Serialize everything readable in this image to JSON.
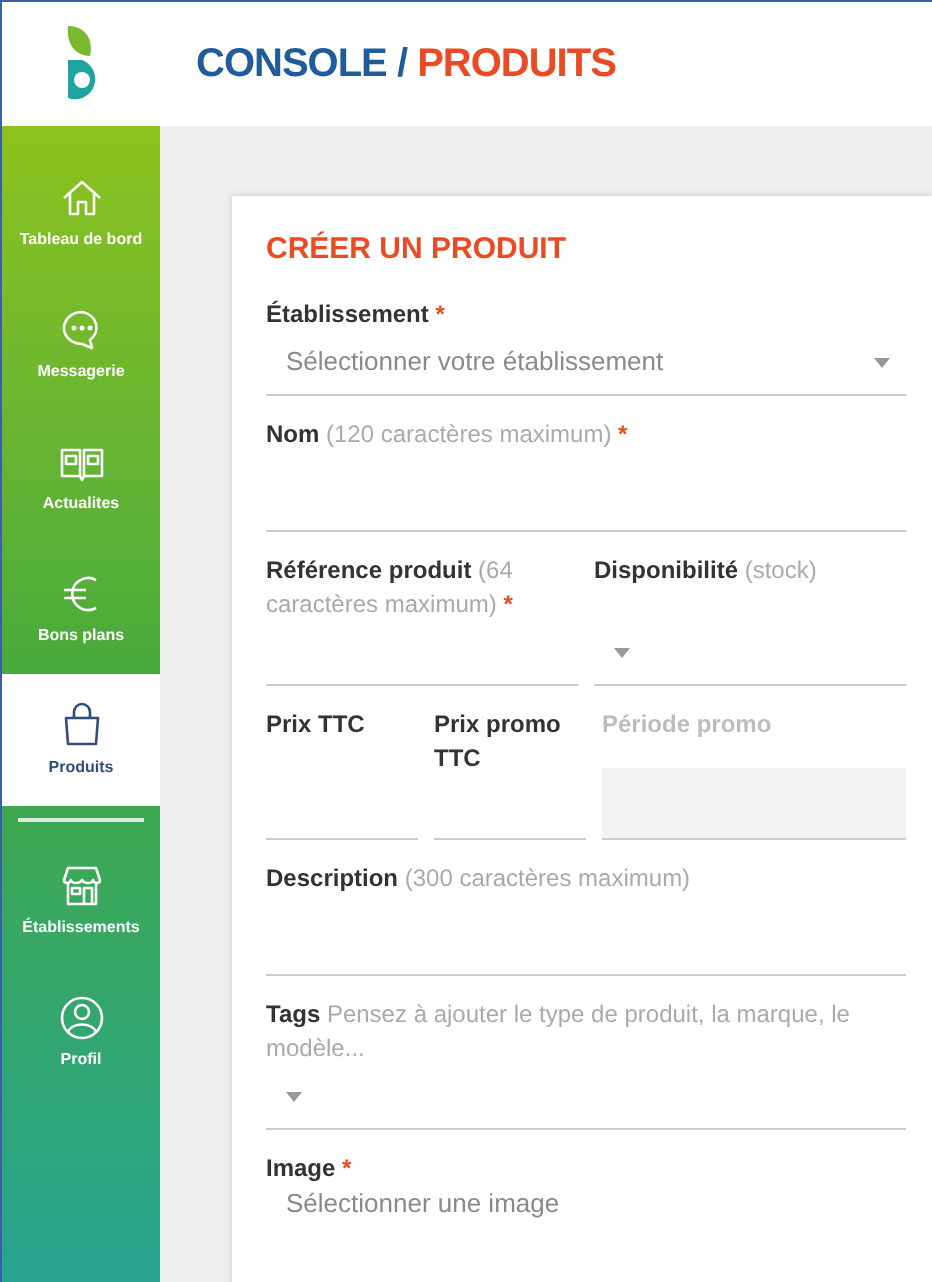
{
  "header": {
    "title": "CONSOLE",
    "separator": " / ",
    "section": "PRODUITS"
  },
  "sidebar": {
    "items": [
      {
        "label": "Tableau de bord",
        "selected": false
      },
      {
        "label": "Messagerie",
        "selected": false
      },
      {
        "label": "Actualites",
        "selected": false
      },
      {
        "label": "Bons plans",
        "selected": false
      },
      {
        "label": "Produits",
        "selected": true
      },
      {
        "label": "Établissements",
        "selected": false
      },
      {
        "label": "Profil",
        "selected": false
      }
    ]
  },
  "form": {
    "title": "CRÉER UN PRODUIT",
    "fields": [
      {
        "label": "Établissement",
        "required_mark": "*",
        "kind": "select",
        "placeholder": "Sélectionner votre établissement"
      },
      {
        "label": "Nom",
        "hint": "(120 caractères maximum)",
        "required_mark": "*",
        "kind": "text"
      },
      {
        "label": "Référence produit",
        "hint": "(64 caractères maximum)",
        "required_mark": "*",
        "kind": "text"
      },
      {
        "label": "Disponibilité",
        "hint": "(stock)",
        "kind": "select"
      },
      {
        "label": "Prix TTC",
        "kind": "text"
      },
      {
        "label": "Prix promo TTC",
        "kind": "text"
      },
      {
        "label": "Période promo",
        "kind": "text",
        "disabled": true
      },
      {
        "label": "Description",
        "hint": "(300 caractères maximum)",
        "kind": "text"
      },
      {
        "label": "Tags",
        "hint": "Pensez à ajouter le type de produit, la marque, le modèle...",
        "kind": "select"
      },
      {
        "label": "Image",
        "required_mark": "*",
        "kind": "select",
        "placeholder": "Sélectionner une image"
      }
    ]
  }
}
